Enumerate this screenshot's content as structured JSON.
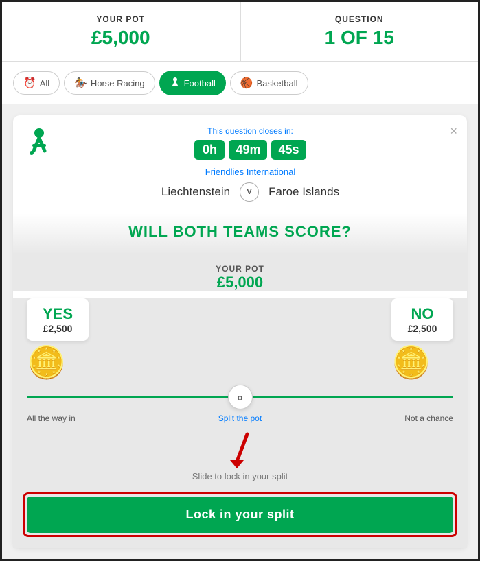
{
  "header": {
    "pot_label": "YOUR POT",
    "pot_value": "£5,000",
    "question_label": "QUESTION",
    "question_value": "1 OF 15"
  },
  "nav": {
    "tabs": [
      {
        "id": "all",
        "label": "All",
        "icon": "⏰",
        "active": false
      },
      {
        "id": "horse-racing",
        "label": "Horse Racing",
        "icon": "🏇",
        "active": false
      },
      {
        "id": "football",
        "label": "Football",
        "icon": "⚽",
        "active": true
      },
      {
        "id": "basketball",
        "label": "Basketball",
        "icon": "🏀",
        "active": false
      }
    ]
  },
  "question_card": {
    "closes_label": "This question closes in:",
    "timer": {
      "hours": "0h",
      "minutes": "49m",
      "seconds": "45s"
    },
    "league": "Friendlies International",
    "team_home": "Liechtenstein",
    "vs": "V",
    "team_away": "Faroe Islands",
    "question_text": "WILL BOTH TEAMS SCORE?",
    "close_icon": "×"
  },
  "pot_split": {
    "label": "YOUR POT",
    "value": "£5,000",
    "yes_label": "YES",
    "yes_amount": "£2,500",
    "no_label": "NO",
    "no_amount": "£2,500"
  },
  "slider": {
    "label_left": "All the way in",
    "label_center": "Split the pot",
    "label_right": "Not a chance",
    "handle_icon": "‹›",
    "slide_hint": "Slide to lock in your split"
  },
  "lock_button": {
    "label": "Lock in your split"
  }
}
